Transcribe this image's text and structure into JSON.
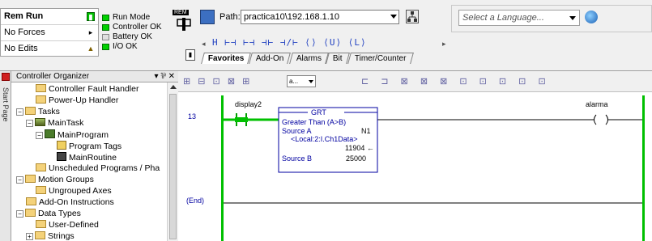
{
  "status": {
    "mode": "Rem Run",
    "forces": "No Forces",
    "edits": "No Edits",
    "leds": [
      {
        "label": "Run Mode",
        "state": "on"
      },
      {
        "label": "Controller OK",
        "state": "on"
      },
      {
        "label": "Battery OK",
        "state": "off"
      },
      {
        "label": "I/O OK",
        "state": "on"
      }
    ],
    "keyswitch": "REM"
  },
  "path": {
    "label": "Path:",
    "value": "practica10\\192.168.1.10"
  },
  "language": {
    "placeholder": "Select a Language..."
  },
  "instruction_bar": {
    "icons": "H  ⊢⊣  ⊢⊣   ⊣⊢ ⊣/⊢ ⟨⟩ ⟨U⟩ ⟨L⟩",
    "tabs": [
      "Favorites",
      "Add-On",
      "Alarms",
      "Bit",
      "Timer/Counter"
    ],
    "active_tab": "Favorites"
  },
  "organizer": {
    "title": "Controller Organizer",
    "controls": "▾ ⅌ ✕",
    "start_page": "Start Page",
    "tree": [
      {
        "label": "Controller Fault Handler",
        "indent": 1,
        "icon": "folder"
      },
      {
        "label": "Power-Up Handler",
        "indent": 1,
        "icon": "folder"
      },
      {
        "label": "Tasks",
        "indent": 0,
        "icon": "folder",
        "expander": "-"
      },
      {
        "label": "MainTask",
        "indent": 1,
        "icon": "task",
        "expander": "-"
      },
      {
        "label": "MainProgram",
        "indent": 2,
        "icon": "program",
        "expander": "-"
      },
      {
        "label": "Program Tags",
        "indent": 3,
        "icon": "tags"
      },
      {
        "label": "MainRoutine",
        "indent": 3,
        "icon": "routine"
      },
      {
        "label": "Unscheduled Programs / Pha",
        "indent": 1,
        "icon": "folder"
      },
      {
        "label": "Motion Groups",
        "indent": 0,
        "icon": "folder",
        "expander": "-"
      },
      {
        "label": "Ungrouped Axes",
        "indent": 1,
        "icon": "folder"
      },
      {
        "label": "Add-On Instructions",
        "indent": 0,
        "icon": "folder"
      },
      {
        "label": "Data Types",
        "indent": 0,
        "icon": "folder",
        "expander": "-"
      },
      {
        "label": "User-Defined",
        "indent": 1,
        "icon": "udt"
      },
      {
        "label": "Strings",
        "indent": 1,
        "icon": "udt",
        "expander": "+"
      }
    ]
  },
  "editor": {
    "toolbar_icons_left": "⊞ ⊟ ⊡ ⊠ ⊞",
    "combo_value": "a...",
    "toolbar_icons_right": "⊏ ⊐ ⊠ ⊠ ⊠ ⊡ ⊡ ⊡ ⊡ ⊡",
    "rungs": [
      {
        "number": "13",
        "contact_tag": "display2",
        "grt": {
          "title": "GRT",
          "desc": "Greater Than (A>B)",
          "source_a_label": "Source A",
          "source_a_value": "N1",
          "source_a_tag": "<Local:2:I.Ch1Data>",
          "source_a_live": "11904 ←",
          "source_b_label": "Source B",
          "source_b_value": "25000"
        },
        "coil_tag": "alarma"
      }
    ],
    "end_label": "(End)"
  }
}
